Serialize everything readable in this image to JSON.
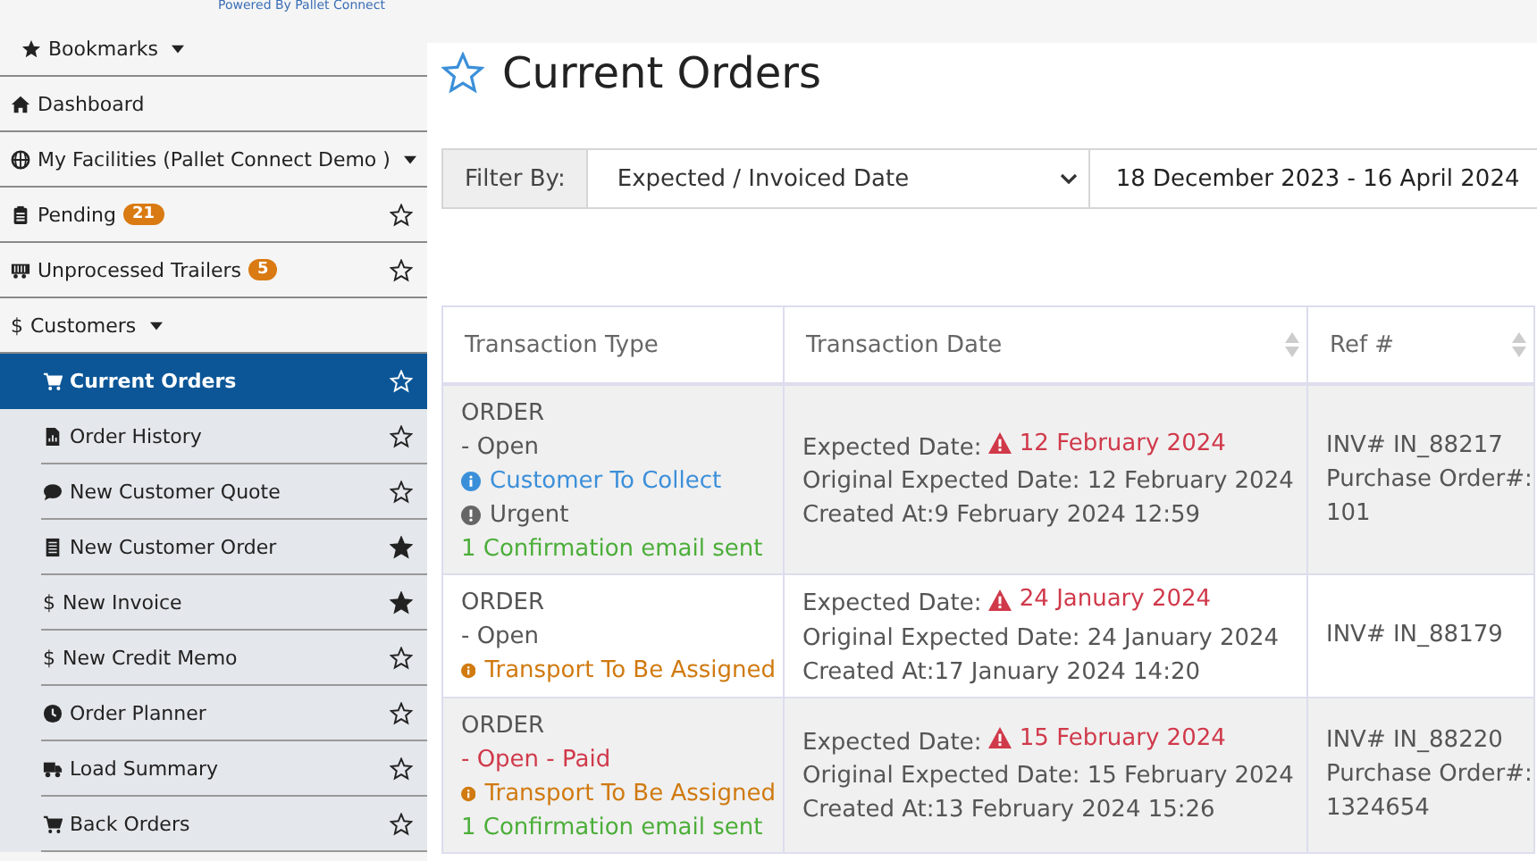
{
  "header": {
    "powered_by": "Powered By Pallet Connect"
  },
  "sidebar": {
    "items": [
      {
        "label": "Bookmarks",
        "dropdown": true
      },
      {
        "label": "Dashboard"
      },
      {
        "label": "My Facilities (Pallet Connect Demo )",
        "dropdown": true
      },
      {
        "label": "Pending",
        "badge": "21",
        "starred": false
      },
      {
        "label": "Unprocessed Trailers",
        "badge": "5",
        "starred": false
      },
      {
        "label": "Customers",
        "icon_char": "$",
        "dropdown": true,
        "children": [
          {
            "label": "Current Orders",
            "starred": false,
            "selected": true
          },
          {
            "label": "Order History",
            "starred": false,
            "selected": false
          },
          {
            "label": "New Customer Quote",
            "starred": false,
            "selected": false
          },
          {
            "label": "New Customer Order",
            "starred": true,
            "selected": false
          },
          {
            "label": "New Invoice",
            "icon_char": "$",
            "starred": true,
            "selected": false
          },
          {
            "label": "New Credit Memo",
            "icon_char": "$",
            "starred": false,
            "selected": false
          },
          {
            "label": "Order Planner",
            "starred": false,
            "selected": false
          },
          {
            "label": "Load Summary",
            "starred": false,
            "selected": false
          },
          {
            "label": "Back Orders",
            "starred": false,
            "selected": false
          }
        ]
      }
    ]
  },
  "page": {
    "title": "Current Orders",
    "bookmarked": false
  },
  "filter": {
    "label": "Filter By:",
    "value": "Expected / Invoiced Date",
    "date_range": "18 December 2023 - 16 April 2024"
  },
  "table": {
    "columns": [
      {
        "label": "Transaction Type",
        "sortable": false
      },
      {
        "label": "Transaction Date",
        "sortable": true
      },
      {
        "label": "Ref #",
        "sortable": true
      }
    ],
    "rows": [
      {
        "type_lines": [
          {
            "text": "ORDER",
            "kind": "plain"
          },
          {
            "text": "- Open",
            "kind": "plain"
          },
          {
            "text": "Customer To Collect",
            "kind": "info"
          },
          {
            "text": "Urgent",
            "kind": "urgent"
          },
          {
            "text": "1 Confirmation email sent",
            "kind": "success"
          }
        ],
        "expected_label": "Expected Date:",
        "expected_date": "12 February 2024",
        "overdue": true,
        "original": "Original Expected Date: 12 February 2024",
        "created": "Created At:9 February 2024 12:59",
        "ref_lines": [
          "INV# IN_88217",
          "Purchase Order#:",
          "101"
        ]
      },
      {
        "type_lines": [
          {
            "text": "ORDER",
            "kind": "plain"
          },
          {
            "text": "- Open",
            "kind": "plain"
          },
          {
            "text": "Transport To Be Assigned",
            "kind": "warning"
          }
        ],
        "expected_label": "Expected Date:",
        "expected_date": "24 January 2024",
        "overdue": true,
        "original": "Original Expected Date: 24 January 2024",
        "created": "Created At:17 January 2024 14:20",
        "ref_lines": [
          "INV# IN_88179"
        ]
      },
      {
        "type_lines": [
          {
            "text": "ORDER",
            "kind": "plain"
          },
          {
            "text": "- Open - Paid",
            "kind": "danger"
          },
          {
            "text": "Transport To Be Assigned",
            "kind": "warning"
          },
          {
            "text": "1 Confirmation email sent",
            "kind": "success"
          }
        ],
        "expected_label": "Expected Date:",
        "expected_date": "15 February 2024",
        "overdue": true,
        "original": "Original Expected Date: 15 February 2024",
        "created": "Created At:13 February 2024 15:26",
        "ref_lines": [
          "INV# IN_88220",
          "Purchase Order#:",
          "1324654"
        ]
      }
    ]
  }
}
